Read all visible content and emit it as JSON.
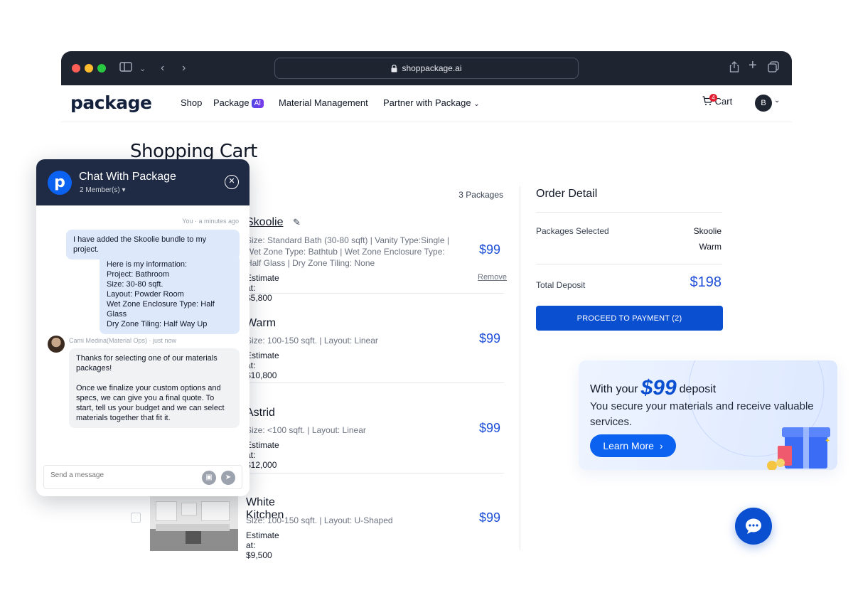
{
  "browser": {
    "url": "shoppackage.ai"
  },
  "nav": {
    "logo": "package",
    "links": [
      "Shop",
      "Package",
      "Material Management",
      "Partner with Package"
    ],
    "ai_badge": "AI",
    "cart_label": "Cart",
    "cart_count": "4",
    "avatar": "B"
  },
  "page": {
    "title": "Shopping Cart",
    "package_count": "3 Packages"
  },
  "items": [
    {
      "name": "Skoolie",
      "spec": "Size: Standard Bath (30-80 sqft) | Vanity Type:Single | Wet Zone Type: Bathtub | Wet Zone Enclosure Type: Half Glass | Dry Zone Tiling: None",
      "estimate": "Estimate at: $5,800",
      "price": "$99",
      "remove": "Remove"
    },
    {
      "name": "Warm",
      "spec": "Size: 100-150 sqft. | Layout: Linear",
      "estimate": "Estimate at: $10,800",
      "price": "$99"
    },
    {
      "name": "Astrid",
      "spec": "Size: <100 sqft. | Layout: Linear",
      "estimate": "Estimate at: $12,000",
      "price": "$99"
    },
    {
      "name": "White Kitchen",
      "spec": "Size: 100-150 sqft. | Layout: U-Shaped",
      "estimate": "Estimate at: $9,500",
      "price": "$99"
    }
  ],
  "order": {
    "title": "Order Detail",
    "packages_label": "Packages Selected",
    "packages": [
      "Skoolie",
      "Warm"
    ],
    "deposit_label": "Total Deposit",
    "deposit_value": "$198",
    "pay_button": "PROCEED TO PAYMENT (2)"
  },
  "promo": {
    "with_your": "With your",
    "amount": "$99",
    "deposit": "deposit",
    "text": "You secure your materials and receive valuable services.",
    "button": "Learn More"
  },
  "chat": {
    "title": "Chat With Package",
    "members": "2 Member(s) ▾",
    "meta_me": "You · a minutes ago",
    "msg1": "I have added the Skoolie bundle to my project.",
    "msg2_lines": [
      "Here is my information:",
      "Project: Bathroom",
      "Size: 30-80 sqft.",
      "Layout: Powder Room",
      "Wet Zone Enclosure Type: Half Glass",
      "Dry Zone Tiling: Half Way Up"
    ],
    "meta_agent": "Cami Medina(Material Ops) · just now",
    "agent_p1": "Thanks for selecting one of our materials packages!",
    "agent_p2": "Once we finalize your custom options and specs, we can give you a final quote. To start, tell us your budget and we can select materials together that fit it.",
    "input_placeholder": "Send a message"
  },
  "colors": {
    "accent": "#0b4fd1",
    "price": "#1d4ed8",
    "dark": "#1f2a44"
  }
}
